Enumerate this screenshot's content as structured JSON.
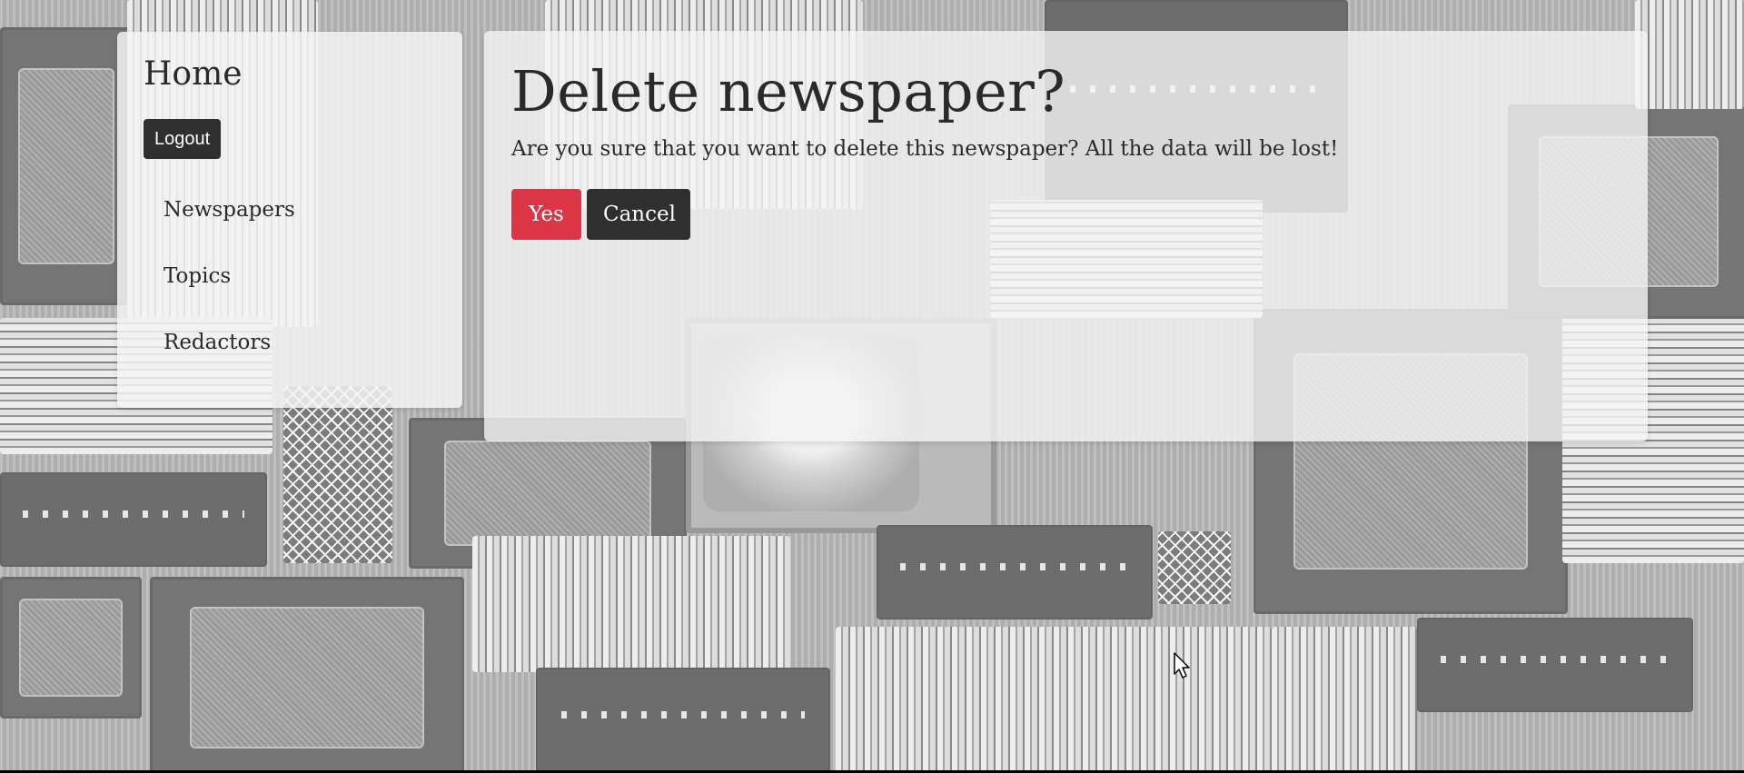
{
  "sidebar": {
    "title": "Home",
    "logout_label": "Logout",
    "nav": [
      {
        "label": "Newspapers"
      },
      {
        "label": "Topics"
      },
      {
        "label": "Redactors"
      }
    ]
  },
  "dialog": {
    "title": "Delete newspaper?",
    "message": "Are you sure that you want to delete this newspaper? All the data will be lost!",
    "confirm_label": "Yes",
    "cancel_label": "Cancel"
  },
  "colors": {
    "danger": "#dc3545",
    "dark": "#2f2f2f",
    "panel": "#f4f4f4"
  },
  "icons": {
    "cursor": "mouse-pointer-icon"
  }
}
